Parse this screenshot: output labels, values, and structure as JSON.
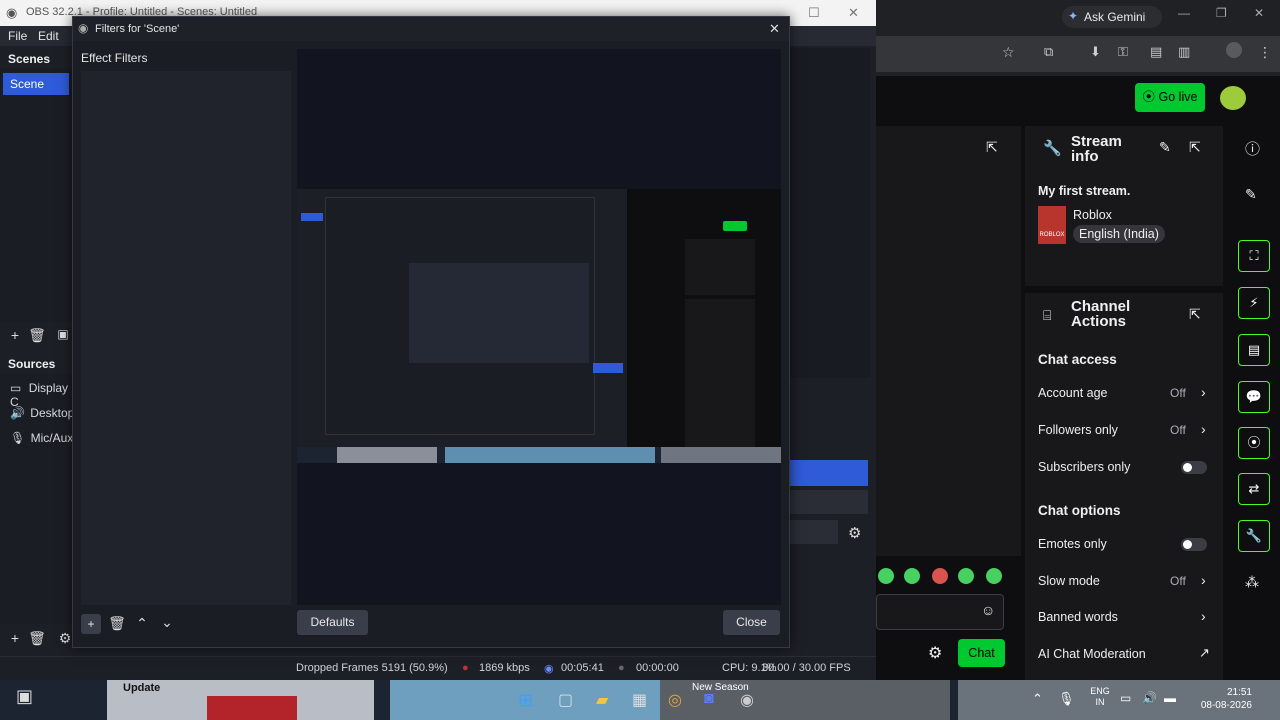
{
  "obs": {
    "title": "OBS 32.2.1 - Profile: Untitled - Scenes: Untitled",
    "menu": [
      "File",
      "Edit"
    ],
    "scenes_header": "Scenes",
    "scene_item": "Scene",
    "sources_header": "Sources",
    "sources": [
      "Display C",
      "Desktop",
      "Mic/Aux"
    ],
    "status": {
      "dropped": "Dropped Frames 5191 (50.9%)",
      "bitrate": "1869 kbps",
      "stream_time": "00:05:41",
      "rec_time": "00:00:00",
      "cpu": "CPU: 9.1%",
      "fps": "30.00 / 30.00 FPS"
    }
  },
  "dialog": {
    "title": "Filters for 'Scene'",
    "effect_filters_label": "Effect Filters",
    "defaults_button": "Defaults",
    "close_button": "Close"
  },
  "browser": {
    "ask_gemini": "Ask Gemini"
  },
  "twitch": {
    "go_live": "Go live",
    "stream_info": {
      "title": "Stream info",
      "stream_title": "My first stream.",
      "category": "Roblox",
      "category_thumb_text": "ROBLOX",
      "language": "English (India)"
    },
    "channel_actions": {
      "title": "Channel Actions",
      "chat_access_header": "Chat access",
      "account_age_label": "Account age",
      "account_age_value": "Off",
      "followers_only_label": "Followers only",
      "followers_only_value": "Off",
      "subscribers_only_label": "Subscribers only",
      "chat_options_header": "Chat options",
      "emotes_only_label": "Emotes only",
      "slow_mode_label": "Slow mode",
      "slow_mode_value": "Off",
      "banned_words_label": "Banned words",
      "ai_moderation_label": "AI Chat Moderation"
    },
    "chat_button": "Chat"
  },
  "taskbar": {
    "update_label": "Update",
    "new_season_label": "New Season",
    "lang_line1": "ENG",
    "lang_line2": "IN",
    "time": "21:51",
    "date": "08-08-2026"
  }
}
